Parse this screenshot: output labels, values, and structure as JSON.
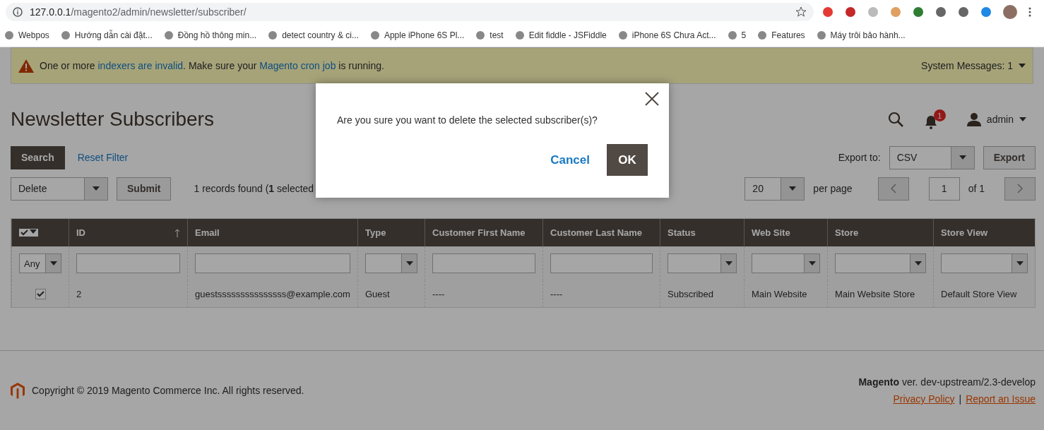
{
  "browser": {
    "url_host": "127.0.0.1",
    "url_path": "/magento2/admin/newsletter/subscriber/",
    "bookmarks": [
      {
        "label": "Webpos"
      },
      {
        "label": "Hướng dẫn cài đặt..."
      },
      {
        "label": "Đồng hồ thông min..."
      },
      {
        "label": "detect country & ci..."
      },
      {
        "label": "Apple iPhone 6S Pl..."
      },
      {
        "label": "test"
      },
      {
        "label": "Edit fiddle - JSFiddle"
      },
      {
        "label": "iPhone 6S Chưa Act..."
      },
      {
        "label": "5"
      },
      {
        "label": "Features"
      },
      {
        "label": "Máy trôi bảo hành..."
      }
    ]
  },
  "notice": {
    "segments": [
      {
        "kind": "text",
        "text": "One or more "
      },
      {
        "kind": "link",
        "text": "indexers are invalid"
      },
      {
        "kind": "text",
        "text": ". Make sure your "
      },
      {
        "kind": "link",
        "text": "Magento cron job"
      },
      {
        "kind": "text",
        "text": " is running."
      }
    ],
    "system_messages": "System Messages: 1"
  },
  "header": {
    "title": "Newsletter Subscribers",
    "notification_count": "1",
    "user": "admin"
  },
  "toolbar": {
    "search_button": "Search",
    "reset_link": "Reset Filter",
    "export_label": "Export to:",
    "export_format": "CSV",
    "export_button": "Export",
    "mass_action": "Delete",
    "submit_button": "Submit",
    "records": "1 records found (**1** selected",
    "per_page_value": "20",
    "per_page_label": "per page",
    "page": "1",
    "page_total": "of 1"
  },
  "table": {
    "columns": [
      {
        "label": "ID",
        "sorted": true
      },
      {
        "label": "Email",
        "sorted": false
      },
      {
        "label": "Type",
        "sorted": false
      },
      {
        "label": "Customer First Name",
        "sorted": false
      },
      {
        "label": "Customer Last Name",
        "sorted": false
      },
      {
        "label": "Status",
        "sorted": false
      },
      {
        "label": "Web Site",
        "sorted": false
      },
      {
        "label": "Store",
        "sorted": false
      },
      {
        "label": "Store View",
        "sorted": false
      }
    ],
    "filters": [
      {
        "kind": "select",
        "value": "Any"
      },
      {
        "kind": "text"
      },
      {
        "kind": "text"
      },
      {
        "kind": "select"
      },
      {
        "kind": "text"
      },
      {
        "kind": "text"
      },
      {
        "kind": "select"
      },
      {
        "kind": "select"
      },
      {
        "kind": "select"
      },
      {
        "kind": "select"
      }
    ],
    "rows": [
      {
        "selected": true,
        "cells": [
          "2",
          "guestsssssssssssssss@example.com",
          "Guest",
          "----",
          "----",
          "Subscribed",
          "Main Website",
          "Main Website Store",
          "Default Store View"
        ]
      }
    ]
  },
  "footer": {
    "copyright": "Copyright © 2019 Magento Commerce Inc. All rights reserved.",
    "brand": "Magento",
    "version": " ver. dev-upstream/2.3-develop",
    "privacy_link": "Privacy Policy",
    "separator": "|",
    "report_link": "Report an Issue"
  },
  "modal": {
    "message": "Are you sure you want to delete the selected subscriber(s)?",
    "cancel_button": "Cancel",
    "ok_button": "OK"
  }
}
